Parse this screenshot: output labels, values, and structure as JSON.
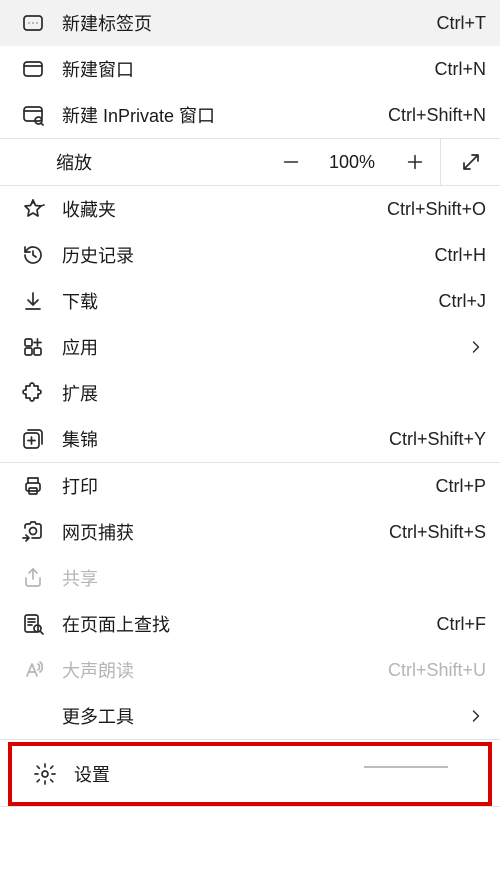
{
  "items": {
    "new_tab": {
      "label": "新建标签页",
      "shortcut": "Ctrl+T"
    },
    "new_window": {
      "label": "新建窗口",
      "shortcut": "Ctrl+N"
    },
    "new_inprivate": {
      "label": "新建 InPrivate 窗口",
      "shortcut": "Ctrl+Shift+N"
    },
    "zoom": {
      "label": "缩放",
      "percent": "100%"
    },
    "favorites": {
      "label": "收藏夹",
      "shortcut": "Ctrl+Shift+O"
    },
    "history": {
      "label": "历史记录",
      "shortcut": "Ctrl+H"
    },
    "downloads": {
      "label": "下载",
      "shortcut": "Ctrl+J"
    },
    "apps": {
      "label": "应用"
    },
    "extensions": {
      "label": "扩展"
    },
    "collections": {
      "label": "集锦",
      "shortcut": "Ctrl+Shift+Y"
    },
    "print": {
      "label": "打印",
      "shortcut": "Ctrl+P"
    },
    "web_capture": {
      "label": "网页捕获",
      "shortcut": "Ctrl+Shift+S"
    },
    "share": {
      "label": "共享"
    },
    "find": {
      "label": "在页面上查找",
      "shortcut": "Ctrl+F"
    },
    "read_aloud": {
      "label": "大声朗读",
      "shortcut": "Ctrl+Shift+U"
    },
    "more_tools": {
      "label": "更多工具"
    },
    "settings": {
      "label": "设置"
    }
  }
}
